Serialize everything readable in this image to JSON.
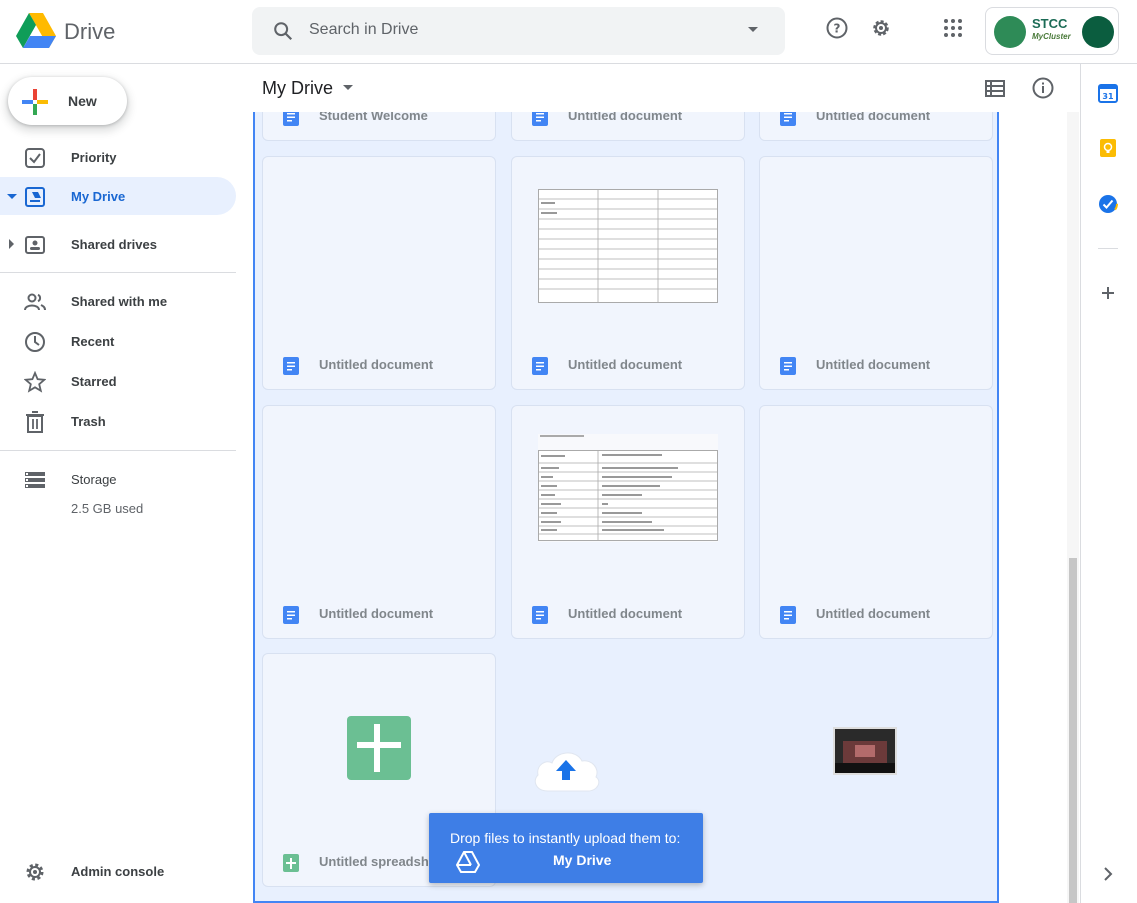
{
  "header": {
    "app_name": "Drive",
    "search_placeholder": "Search in Drive",
    "account_brand": "STCC",
    "account_brand_sub": "MyCluster"
  },
  "sidebar": {
    "new_label": "New",
    "items": [
      {
        "label": "Priority",
        "icon": "checkbox-icon"
      },
      {
        "label": "My Drive",
        "icon": "my-drive-icon",
        "active": true
      },
      {
        "label": "Shared drives",
        "icon": "shared-drives-icon"
      },
      {
        "label": "Shared with me",
        "icon": "people-icon"
      },
      {
        "label": "Recent",
        "icon": "clock-icon"
      },
      {
        "label": "Starred",
        "icon": "star-icon"
      },
      {
        "label": "Trash",
        "icon": "trash-icon"
      },
      {
        "label": "Storage",
        "icon": "storage-icon"
      }
    ],
    "storage_used": "2.5 GB used",
    "admin_label": "Admin console"
  },
  "main": {
    "title": "My Drive",
    "files": [
      {
        "name": "Student Welcome",
        "type": "doc"
      },
      {
        "name": "Untitled document",
        "type": "doc"
      },
      {
        "name": "Untitled document",
        "type": "doc"
      },
      {
        "name": "Untitled document",
        "type": "doc"
      },
      {
        "name": "Untitled document",
        "type": "doc"
      },
      {
        "name": "Untitled document",
        "type": "doc"
      },
      {
        "name": "Untitled document",
        "type": "doc"
      },
      {
        "name": "Untitled document",
        "type": "doc"
      },
      {
        "name": "Untitled document",
        "type": "doc"
      },
      {
        "name": "Untitled spreadsheet",
        "type": "sheet"
      }
    ]
  },
  "upload_toast": {
    "line1": "Drop files to instantly upload them to:",
    "line2": "My Drive"
  },
  "colors": {
    "accent": "#1967d2",
    "drop_border": "#4285f4",
    "toast_bg": "#3e7ee6",
    "doc_icon": "#4285f4",
    "sheet_icon": "#0f9d58"
  }
}
